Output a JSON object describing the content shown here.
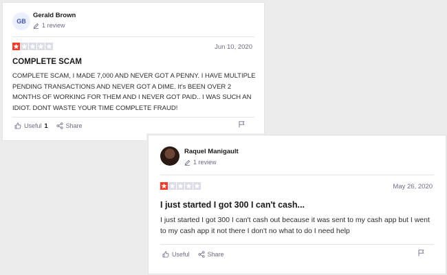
{
  "reviews": [
    {
      "avatar_initials": "GB",
      "reviewer_name": "Gerald Brown",
      "review_count": "1 review",
      "rating": 1,
      "date": "Jun 10, 2020",
      "title": "COMPLETE SCAM",
      "body": "COMPLETE SCAM, I MADE 7,000 AND NEVER GOT A PENNY. I HAVE MULTIPLE PENDING TRANSACTIONS AND NEVER GOT A DIME. It's BEEN OVER 2 MONTHS OF WORKING FOR THEM AND I NEVER GOT PAID.. I WAS SUCH AN IDIOT. DONT WASTE YOUR TIME COMPLETE FRAUD!",
      "useful_label": "Useful",
      "useful_count": "1",
      "share_label": "Share"
    },
    {
      "avatar_initials": "",
      "reviewer_name": "Raquel Manigault",
      "review_count": "1 review",
      "rating": 1,
      "date": "May 26, 2020",
      "title": "I just started I got 300 I can't cash...",
      "body": "I just started I got 300 I can't cash out because it was sent to my cash app but I went to my cash app it not there I don't no what to do I need help",
      "useful_label": "Useful",
      "useful_count": "",
      "share_label": "Share"
    }
  ],
  "colors": {
    "star_filled": "#ff3722",
    "star_empty": "#dcdce6",
    "muted_text": "#6c6c85"
  },
  "icons": [
    "pencil-icon",
    "star-icon",
    "thumbs-up-icon",
    "share-icon",
    "flag-icon"
  ]
}
